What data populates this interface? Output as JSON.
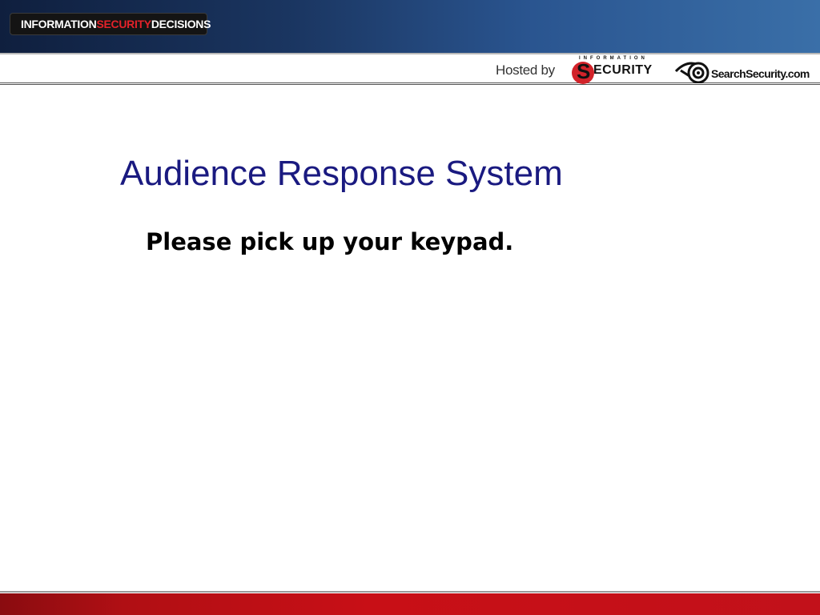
{
  "header": {
    "brand": {
      "part1": "INFORMATION ",
      "part2": "SECURITY",
      "part3": " DECISIONS"
    },
    "hosted_by_label": "Hosted by",
    "logos": [
      {
        "name": "Information Security",
        "small_text": "INFORMATION",
        "big_letter": "S",
        "word": "ECURITY"
      },
      {
        "name": "SearchSecurity.com",
        "text": "SearchSecurity.com"
      }
    ]
  },
  "slide": {
    "title": "Audience Response System",
    "subtitle": "Please pick up your keypad."
  },
  "colors": {
    "banner_dark": "#0f1f3e",
    "banner_light": "#3a6fa8",
    "title_blue": "#1a1a80",
    "brand_red": "#e3222a",
    "footer_red": "#c80f16"
  }
}
